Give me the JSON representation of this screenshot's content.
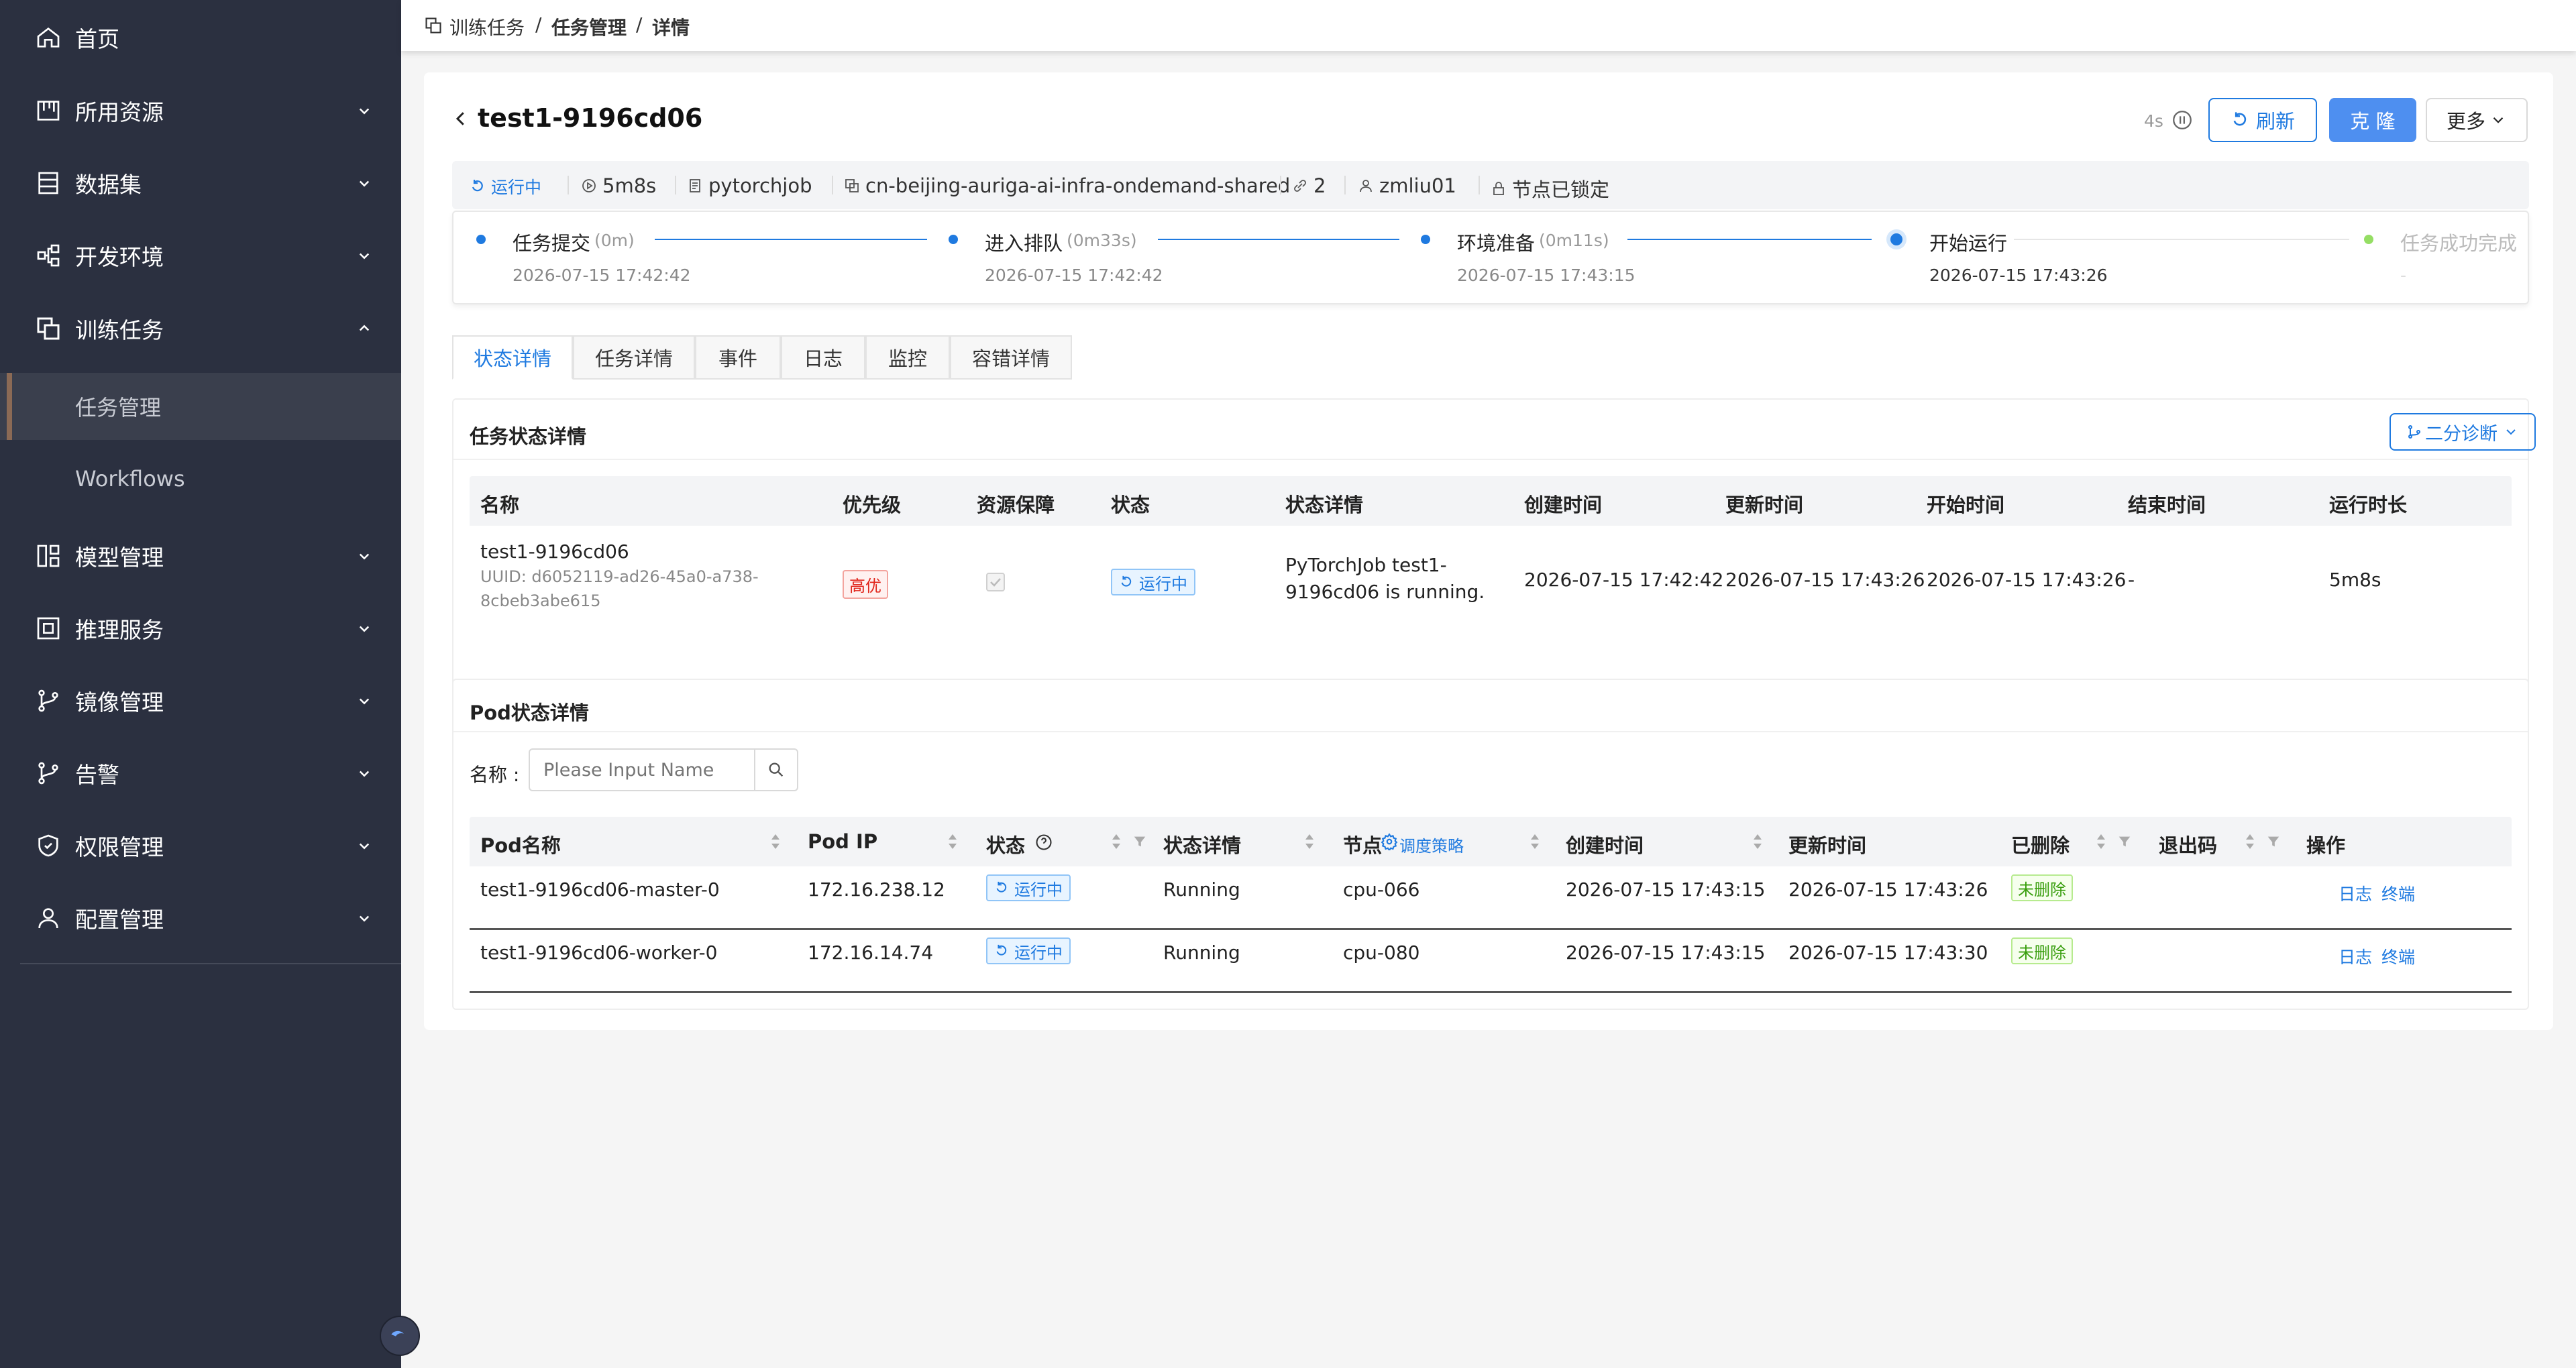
{
  "sidebar": {
    "items": [
      {
        "label": "首页",
        "icon": "home-icon"
      },
      {
        "label": "所用资源",
        "icon": "resource-icon"
      },
      {
        "label": "数据集",
        "icon": "dataset-icon"
      },
      {
        "label": "开发环境",
        "icon": "dev-env-icon"
      },
      {
        "label": "训练任务",
        "icon": "training-icon",
        "expanded": true,
        "children": [
          {
            "label": "任务管理",
            "active": true
          },
          {
            "label": "Workflows"
          }
        ]
      },
      {
        "label": "模型管理",
        "icon": "model-icon"
      },
      {
        "label": "推理服务",
        "icon": "inference-icon"
      },
      {
        "label": "镜像管理",
        "icon": "image-icon"
      },
      {
        "label": "告警",
        "icon": "alert-icon"
      },
      {
        "label": "权限管理",
        "icon": "shield-icon"
      },
      {
        "label": "配置管理",
        "icon": "user-icon"
      }
    ]
  },
  "breadcrumb": {
    "items": [
      "训练任务",
      "任务管理",
      "详情"
    ],
    "sep": "/"
  },
  "header": {
    "title": "test1-9196cd06",
    "refresh_interval": "4s",
    "refresh_label": "刷新",
    "clone_label": "克 隆",
    "more_label": "更多"
  },
  "meta": {
    "status": "运行中",
    "duration": "5m8s",
    "framework": "pytorchjob",
    "cluster": "cn-beijing-auriga-ai-infra-ondemand-shared",
    "replicas": "2",
    "owner": "zmliu01",
    "node_lock": "节点已锁定"
  },
  "steps": [
    {
      "title": "任务提交",
      "sub": "(0m)",
      "time": "2026-07-15 17:42:42"
    },
    {
      "title": "进入排队",
      "sub": "(0m33s)",
      "time": "2026-07-15 17:42:42"
    },
    {
      "title": "环境准备",
      "sub": "(0m11s)",
      "time": "2026-07-15 17:43:15"
    },
    {
      "title": "开始运行",
      "sub": "",
      "time": "2026-07-15 17:43:26"
    },
    {
      "title": "任务成功完成",
      "sub": "",
      "time": "-"
    }
  ],
  "tabs": [
    "状态详情",
    "任务详情",
    "事件",
    "日志",
    "监控",
    "容错详情"
  ],
  "task_status": {
    "title": "任务状态详情",
    "diagnose_label": "二分诊断",
    "columns": [
      "名称",
      "优先级",
      "资源保障",
      "状态",
      "状态详情",
      "创建时间",
      "更新时间",
      "开始时间",
      "结束时间",
      "运行时长"
    ],
    "row": {
      "name": "test1-9196cd06",
      "uuid_line1": "UUID: d6052119-ad26-45a0-a738-",
      "uuid_line2": "8cbeb3abe615",
      "priority": "高优",
      "status": "运行中",
      "detail_line1": "PyTorchJob test1-",
      "detail_line2": "9196cd06 is running.",
      "created": "2026-07-15 17:42:42",
      "updated": "2026-07-15 17:43:26",
      "started": "2026-07-15 17:43:26",
      "ended": "-",
      "duration": "5m8s"
    }
  },
  "pod_status": {
    "title": "Pod状态详情",
    "name_label": "名称 :",
    "search_placeholder": "Please Input Name",
    "columns": {
      "pod_name": "Pod名称",
      "pod_ip": "Pod IP",
      "status": "状态",
      "status_detail": "状态详情",
      "node": "节点",
      "schedule": "调度策略",
      "created": "创建时间",
      "updated": "更新时间",
      "deleted": "已删除",
      "exit_code": "退出码",
      "actions": "操作"
    },
    "rows": [
      {
        "name": "test1-9196cd06-master-0",
        "ip": "172.16.238.12",
        "status": "运行中",
        "detail": "Running",
        "node": "cpu-066",
        "created": "2026-07-15 17:43:15",
        "updated": "2026-07-15 17:43:26",
        "deleted": "未删除",
        "exit_code": "",
        "log": "日志",
        "terminal": "终端"
      },
      {
        "name": "test1-9196cd06-worker-0",
        "ip": "172.16.14.74",
        "status": "运行中",
        "detail": "Running",
        "node": "cpu-080",
        "created": "2026-07-15 17:43:15",
        "updated": "2026-07-15 17:43:30",
        "deleted": "未删除",
        "exit_code": "",
        "log": "日志",
        "terminal": "终端"
      }
    ]
  },
  "colors": {
    "accent": "#1f7ae0",
    "sidebar_bg": "#2b3040",
    "danger": "#e1251b",
    "success": "#389e0d"
  }
}
